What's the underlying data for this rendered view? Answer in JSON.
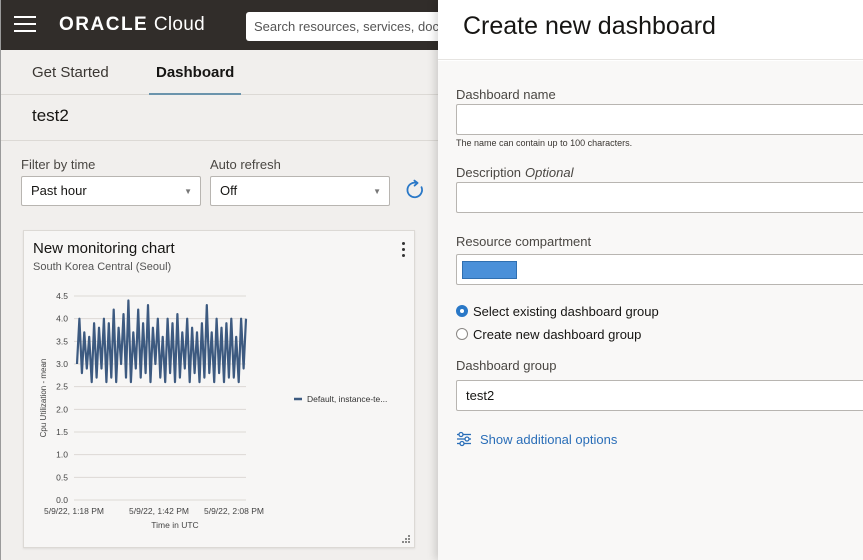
{
  "topbar": {
    "brand_strong": "ORACLE",
    "brand_light": " Cloud",
    "search_placeholder": "Search resources, services, docum"
  },
  "tabs": [
    {
      "label": "Get Started",
      "active": false
    },
    {
      "label": "Dashboard",
      "active": true
    }
  ],
  "dashboard": {
    "title": "test2",
    "filter_label": "Filter by time",
    "filter_value": "Past hour",
    "refresh_label": "Auto refresh",
    "refresh_value": "Off"
  },
  "card": {
    "title": "New monitoring chart",
    "subtitle": "South Korea Central (Seoul)"
  },
  "chart_data": {
    "type": "line",
    "ylabel": "Cpu Utilization - mean",
    "xlabel": "Time in UTC",
    "ylim": [
      0,
      4.5
    ],
    "yticks": [
      "0.0",
      "0.5",
      "1.0",
      "1.5",
      "2.0",
      "2.5",
      "3.0",
      "3.5",
      "4.0",
      "4.5"
    ],
    "xticks": [
      "5/9/22, 1:18 PM",
      "5/9/22, 1:42 PM",
      "5/9/22, 2:08 PM"
    ],
    "legend_position": "right",
    "series_color": "#3d5a80",
    "series": [
      {
        "name": "Default, instance-te...",
        "values": [
          3.0,
          4.0,
          2.8,
          3.7,
          2.9,
          3.6,
          2.6,
          3.9,
          2.7,
          3.8,
          2.9,
          4.0,
          2.6,
          3.9,
          2.7,
          4.2,
          2.6,
          3.8,
          3.0,
          4.1,
          2.7,
          4.4,
          2.6,
          3.7,
          2.9,
          4.2,
          2.7,
          3.9,
          2.8,
          4.3,
          2.6,
          3.8,
          3.0,
          4.0,
          2.7,
          3.6,
          2.6,
          4.0,
          2.8,
          3.9,
          2.6,
          4.1,
          2.7,
          3.7,
          2.9,
          4.0,
          2.6,
          3.8,
          2.8,
          3.7,
          2.6,
          3.9,
          2.7,
          4.3,
          2.8,
          3.7,
          2.6,
          4.0,
          2.8,
          3.8,
          2.6,
          3.9,
          2.7,
          4.0,
          2.7,
          3.6,
          2.6,
          4.0,
          2.9,
          4.0
        ]
      }
    ]
  },
  "panel": {
    "title": "Create new dashboard",
    "name_label": "Dashboard name",
    "name_value": "",
    "name_hint": "The name can contain up to 100 characters.",
    "desc_label": "Description",
    "desc_optional": "Optional",
    "desc_value": "",
    "compartment_label": "Resource compartment",
    "radio_existing": "Select existing dashboard group",
    "radio_new": "Create new dashboard group",
    "group_label": "Dashboard group",
    "group_value": "test2",
    "additional_link": "Show additional options"
  },
  "colors": {
    "topbar": "#312d2a",
    "link": "#2a6eb8",
    "radio_selected": "#2a78c7",
    "compartment_chip": "#4a90d9"
  }
}
